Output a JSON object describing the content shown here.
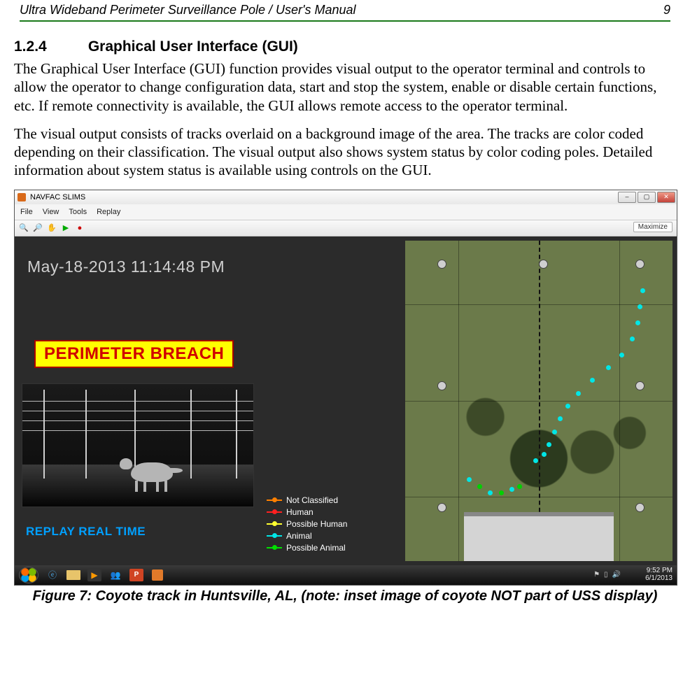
{
  "header": {
    "title": "Ultra Wideband Perimeter Surveillance Pole / User's Manual",
    "page_number": "9"
  },
  "section": {
    "number": "1.2.4",
    "title": "Graphical User Interface (GUI)"
  },
  "paragraphs": {
    "p1": "The Graphical User Interface (GUI) function provides visual output to the operator terminal and controls to allow the operator to change configuration data, start and stop the system, enable or disable certain functions, etc.  If remote connectivity is available, the GUI allows remote access to the operator terminal.",
    "p2": "The visual output consists of tracks overlaid on a background image of the area. The tracks are color coded depending on their classification. The visual output also shows system status by color coding poles. Detailed information about system status is available using controls on the GUI."
  },
  "gui": {
    "window_title": "NAVFAC SLIMS",
    "menu": {
      "file": "File",
      "view": "View",
      "tools": "Tools",
      "replay": "Replay"
    },
    "toolbar": {
      "maximize_label": "Maximize"
    },
    "timestamp": "May-18-2013 11:14:48 PM",
    "breach_label": "PERIMETER BREACH",
    "replay_mode": "REPLAY REAL TIME",
    "legend": {
      "not_classified": {
        "label": "Not Classified",
        "color": "#ff8000"
      },
      "human": {
        "label": "Human",
        "color": "#ff2020"
      },
      "possible_human": {
        "label": "Possible Human",
        "color": "#ffff30"
      },
      "animal": {
        "label": "Animal",
        "color": "#00e6e6"
      },
      "possible_animal": {
        "label": "Possible Animal",
        "color": "#00e000"
      }
    },
    "win_buttons": {
      "minimize": "–",
      "maximize": "▢",
      "close": "✕"
    }
  },
  "taskbar": {
    "time": "9:52 PM",
    "date": "6/1/2013"
  },
  "figure_caption": "Figure 7:  Coyote track in Huntsville, AL, (note: inset image of coyote NOT part of USS display)"
}
